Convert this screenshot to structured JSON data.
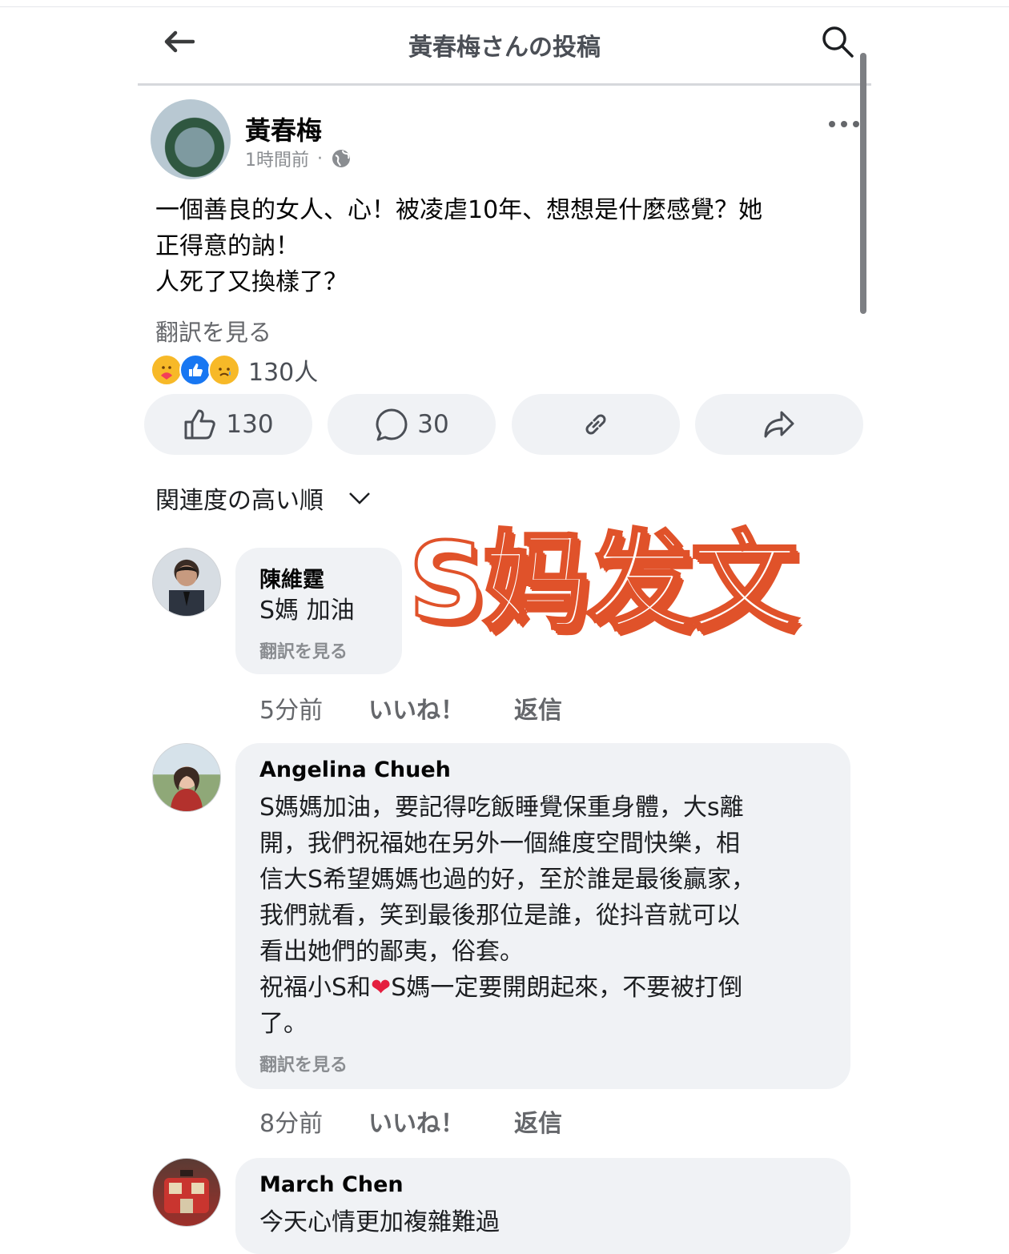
{
  "header": {
    "title": "黃春梅さんの投稿"
  },
  "post": {
    "author": "黃春梅",
    "time": "1時間前",
    "separator": "·",
    "lines": [
      "一個善良的女人、心！被凌虐10年、想想是什麼感覺？她",
      "正得意的訥！",
      "人死了又換樣了？"
    ],
    "translate": "翻訳を見る",
    "reaction_summary": "130人",
    "actions": {
      "like_count": "130",
      "comment_count": "30"
    }
  },
  "sort": {
    "label": "関連度の高い順"
  },
  "overlay": {
    "text": "S妈发文"
  },
  "comments": [
    {
      "name": "陳維霆",
      "lines": [
        "S媽 加油"
      ],
      "translate": "翻訳を見る",
      "time": "5分前",
      "like": "いいね！",
      "reply": "返信"
    },
    {
      "name": "Angelina Chueh",
      "lines": [
        "S媽媽加油，要記得吃飯睡覺保重身體，大s離",
        "開，我們祝福她在另外一個維度空間快樂，相",
        "信大S希望媽媽也過的好，至於誰是最後贏家，",
        "我們就看，笑到最後那位是誰，從抖音就可以",
        "看出她們的鄙夷，俗套。"
      ],
      "line6_before": "祝福小S和",
      "line6_after": "S媽一定要開朗起來，不要被打倒",
      "line7": "了。",
      "translate": "翻訳を見る",
      "time": "8分前",
      "like": "いいね！",
      "reply": "返信"
    },
    {
      "name": "March Chen",
      "lines": [
        "今天心情更加複雜難過"
      ]
    }
  ],
  "colors": {
    "overlay_fill": "#ffffff",
    "overlay_outline": "#e0522a",
    "bubble": "#f0f2f5"
  }
}
